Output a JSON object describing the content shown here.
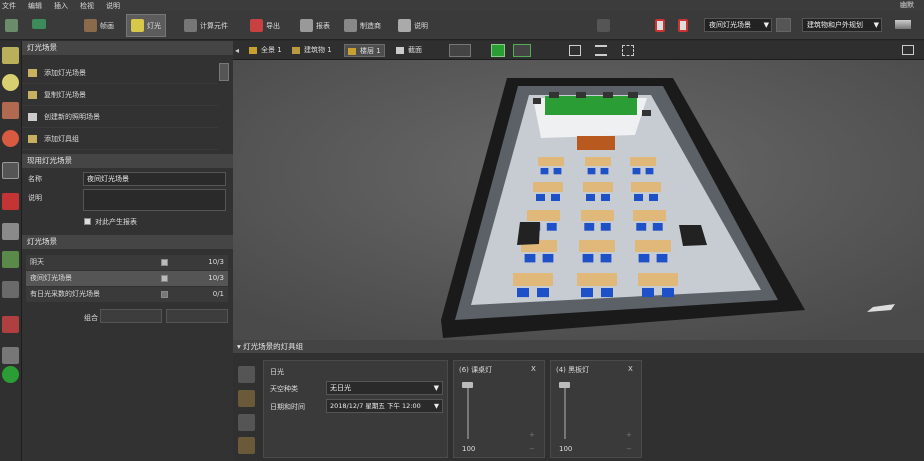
{
  "menu": [
    "文件",
    "编辑",
    "插入",
    "检视",
    "说明"
  ],
  "menu_right": "幽默",
  "toolbar": {
    "items": [
      {
        "label": "帧画",
        "icon": "chair-icon"
      },
      {
        "label": "灯光",
        "icon": "lamp-icon"
      },
      {
        "label": "计算元件",
        "icon": "calc-icon"
      },
      {
        "label": "导出",
        "icon": "export-icon"
      },
      {
        "label": "报表",
        "icon": "report-icon"
      },
      {
        "label": "制造商",
        "icon": "factory-icon"
      },
      {
        "label": "说明",
        "icon": "help-icon"
      }
    ],
    "scene_select": "夜间灯光场景",
    "view_select": "建筑物和户外规划"
  },
  "scenes_panel": {
    "title": "灯光场景",
    "actions": [
      "添加灯光场景",
      "复制灯光场景",
      "创建新的照明场景",
      "添加灯具组"
    ]
  },
  "props_panel": {
    "title": "现用灯光场景",
    "name_label": "名称",
    "name_value": "夜间灯光场景",
    "desc_label": "说明",
    "report_label": "对此产生报表"
  },
  "list_panel": {
    "title": "灯光场景",
    "rows": [
      {
        "name": "阴天",
        "value": "10/3"
      },
      {
        "name": "夜间灯光场景",
        "value": "10/3"
      },
      {
        "name": "有日光采数的灯光场景",
        "value": "0/1"
      }
    ],
    "combine_label": "组合"
  },
  "view_tools": {
    "tabs": [
      "全景 1",
      "建筑物 1",
      "楼层 1",
      "截面"
    ]
  },
  "bottom": {
    "title": "灯光场景的灯具组",
    "daylight": {
      "title": "日光",
      "sky_label": "天空种类",
      "sky_value": "无日光",
      "date_label": "日期和时间",
      "date_value": "2018/12/7 星期五 下午 12:00"
    },
    "groups": [
      {
        "title": "(6) 课桌灯",
        "close": "X",
        "value": "100"
      },
      {
        "title": "(4) 黑板灯",
        "close": "X",
        "value": "100"
      }
    ]
  },
  "colors": {
    "accent": "#2a9e34",
    "panel": "#323232",
    "chair": "#1e50c8",
    "desk": "#e0b97a"
  }
}
